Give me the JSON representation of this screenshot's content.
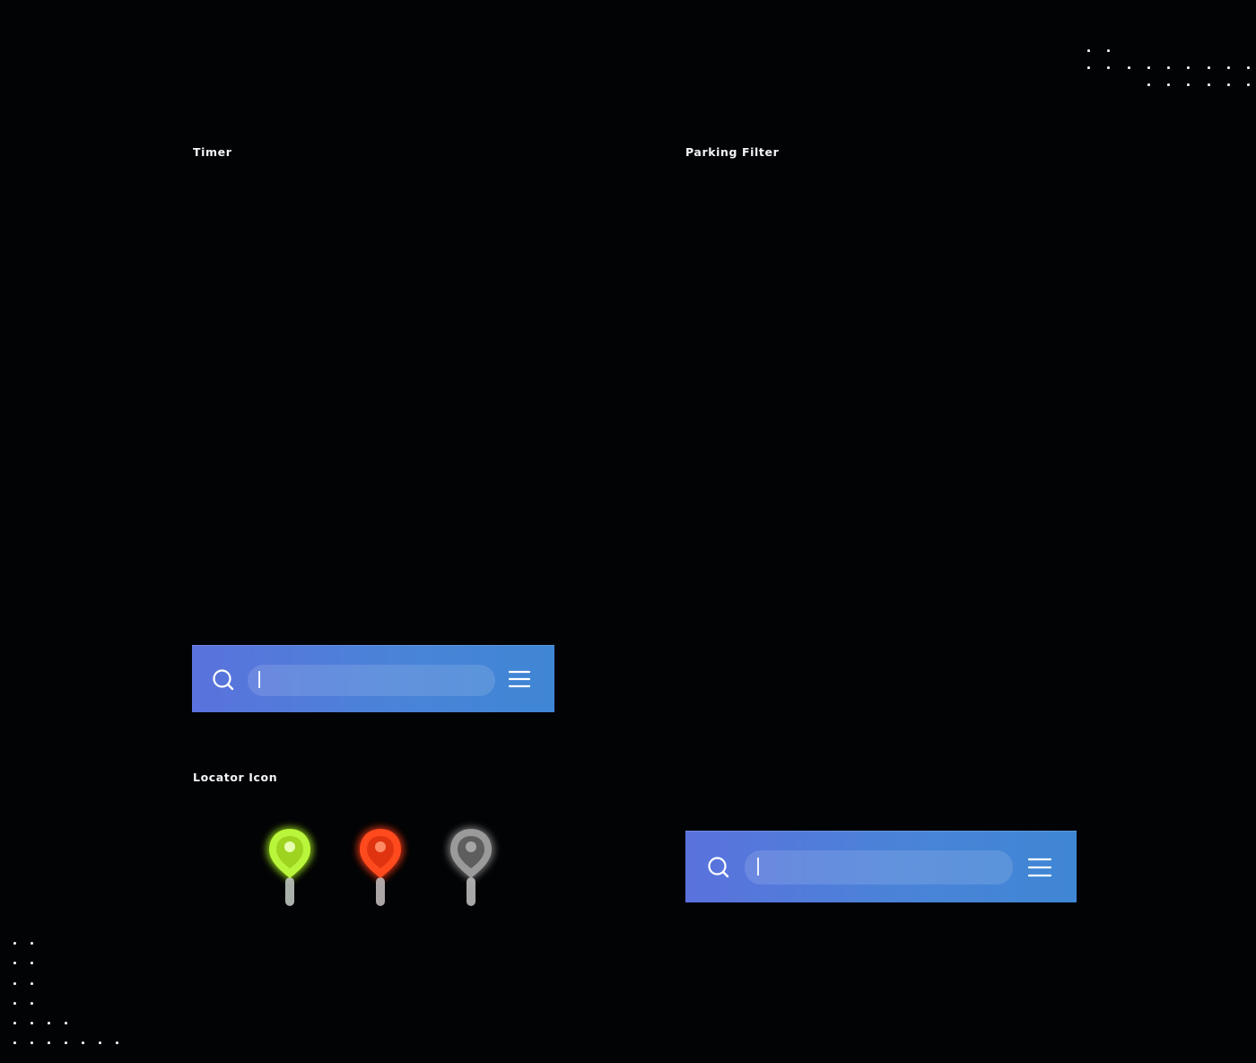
{
  "sections": {
    "timer": {
      "title": "Timer"
    },
    "parking_filter": {
      "title": "Parking Filter"
    },
    "locator_icon": {
      "title": "Locator Icon"
    }
  },
  "search_bars": [
    {
      "id": "timer-search",
      "value": "",
      "icon": "search-icon",
      "menu_icon": "hamburger-menu-icon"
    },
    {
      "id": "parking-search",
      "value": "",
      "icon": "search-icon",
      "menu_icon": "hamburger-menu-icon"
    }
  ],
  "locators": [
    {
      "status": "available",
      "color": "#a8f01a",
      "icon": "location-pin-icon"
    },
    {
      "status": "occupied",
      "color": "#ff3a12",
      "icon": "location-pin-icon"
    },
    {
      "status": "unavailable",
      "color": "#8c8c8c",
      "icon": "location-pin-icon"
    }
  ],
  "colors": {
    "background": "#020305",
    "bar_gradient_start": "#5a72dd",
    "bar_gradient_end": "#3f86d4",
    "text": "#f2f4f8"
  }
}
